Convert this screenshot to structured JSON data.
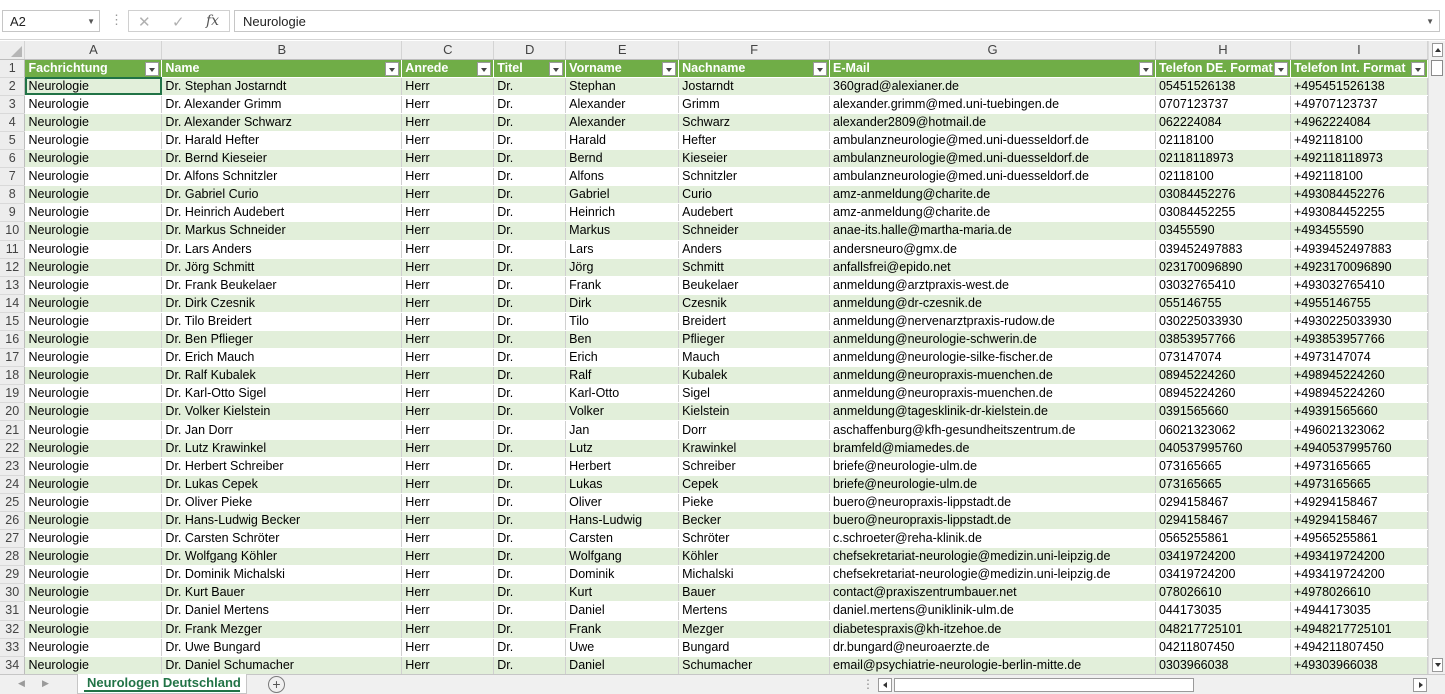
{
  "formula_bar": {
    "name_box": "A2",
    "formula_content": "Neurologie"
  },
  "columns": [
    "A",
    "B",
    "C",
    "D",
    "E",
    "F",
    "G",
    "H",
    "I"
  ],
  "table_headers": [
    "Fachrichtung",
    "Name",
    "Anrede",
    "Titel",
    "Vorname",
    "Nachname",
    "E-Mail",
    "Telefon DE. Format",
    "Telefon Int. Format"
  ],
  "rows": [
    [
      "Neurologie",
      "Dr. Stephan Jostarndt",
      "Herr",
      "Dr.",
      "Stephan",
      "Jostarndt",
      "360grad@alexianer.de",
      "05451526138",
      "+495451526138"
    ],
    [
      "Neurologie",
      "Dr. Alexander Grimm",
      "Herr",
      "Dr.",
      "Alexander",
      "Grimm",
      "alexander.grimm@med.uni-tuebingen.de",
      "0707123737",
      "+49707123737"
    ],
    [
      "Neurologie",
      "Dr. Alexander Schwarz",
      "Herr",
      "Dr.",
      "Alexander",
      "Schwarz",
      "alexander2809@hotmail.de",
      "062224084",
      "+4962224084"
    ],
    [
      "Neurologie",
      "Dr. Harald Hefter",
      "Herr",
      "Dr.",
      "Harald",
      "Hefter",
      "ambulanzneurologie@med.uni-duesseldorf.de",
      "02118100",
      "+492118100"
    ],
    [
      "Neurologie",
      "Dr. Bernd Kieseier",
      "Herr",
      "Dr.",
      "Bernd",
      "Kieseier",
      "ambulanzneurologie@med.uni-duesseldorf.de",
      "02118118973",
      "+492118118973"
    ],
    [
      "Neurologie",
      "Dr. Alfons Schnitzler",
      "Herr",
      "Dr.",
      "Alfons",
      "Schnitzler",
      "ambulanzneurologie@med.uni-duesseldorf.de",
      "02118100",
      "+492118100"
    ],
    [
      "Neurologie",
      "Dr. Gabriel Curio",
      "Herr",
      "Dr.",
      "Gabriel",
      "Curio",
      "amz-anmeldung@charite.de",
      "03084452276",
      "+493084452276"
    ],
    [
      "Neurologie",
      "Dr. Heinrich Audebert",
      "Herr",
      "Dr.",
      "Heinrich",
      "Audebert",
      "amz-anmeldung@charite.de",
      "03084452255",
      "+493084452255"
    ],
    [
      "Neurologie",
      "Dr. Markus Schneider",
      "Herr",
      "Dr.",
      "Markus",
      "Schneider",
      "anae-its.halle@martha-maria.de",
      "03455590",
      "+493455590"
    ],
    [
      "Neurologie",
      "Dr. Lars Anders",
      "Herr",
      "Dr.",
      "Lars",
      "Anders",
      "andersneuro@gmx.de",
      "039452497883",
      "+4939452497883"
    ],
    [
      "Neurologie",
      "Dr. Jörg Schmitt",
      "Herr",
      "Dr.",
      "Jörg",
      "Schmitt",
      "anfallsfrei@epido.net",
      "023170096890",
      "+4923170096890"
    ],
    [
      "Neurologie",
      "Dr. Frank Beukelaer",
      "Herr",
      "Dr.",
      "Frank",
      "Beukelaer",
      "anmeldung@arztpraxis-west.de",
      "03032765410",
      "+493032765410"
    ],
    [
      "Neurologie",
      "Dr. Dirk Czesnik",
      "Herr",
      "Dr.",
      "Dirk",
      "Czesnik",
      "anmeldung@dr-czesnik.de",
      "055146755",
      "+4955146755"
    ],
    [
      "Neurologie",
      "Dr. Tilo Breidert",
      "Herr",
      "Dr.",
      "Tilo",
      "Breidert",
      "anmeldung@nervenarztpraxis-rudow.de",
      "030225033930",
      "+4930225033930"
    ],
    [
      "Neurologie",
      "Dr. Ben Pflieger",
      "Herr",
      "Dr.",
      "Ben",
      "Pflieger",
      "anmeldung@neurologie-schwerin.de",
      "03853957766",
      "+493853957766"
    ],
    [
      "Neurologie",
      "Dr. Erich Mauch",
      "Herr",
      "Dr.",
      "Erich",
      "Mauch",
      "anmeldung@neurologie-silke-fischer.de",
      "073147074",
      "+4973147074"
    ],
    [
      "Neurologie",
      "Dr. Ralf Kubalek",
      "Herr",
      "Dr.",
      "Ralf",
      "Kubalek",
      "anmeldung@neuropraxis-muenchen.de",
      "08945224260",
      "+498945224260"
    ],
    [
      "Neurologie",
      "Dr. Karl-Otto Sigel",
      "Herr",
      "Dr.",
      "Karl-Otto",
      "Sigel",
      "anmeldung@neuropraxis-muenchen.de",
      "08945224260",
      "+498945224260"
    ],
    [
      "Neurologie",
      "Dr. Volker Kielstein",
      "Herr",
      "Dr.",
      "Volker",
      "Kielstein",
      "anmeldung@tagesklinik-dr-kielstein.de",
      "0391565660",
      "+49391565660"
    ],
    [
      "Neurologie",
      "Dr. Jan Dorr",
      "Herr",
      "Dr.",
      "Jan",
      "Dorr",
      "aschaffenburg@kfh-gesundheitszentrum.de",
      "06021323062",
      "+496021323062"
    ],
    [
      "Neurologie",
      "Dr. Lutz Krawinkel",
      "Herr",
      "Dr.",
      "Lutz",
      "Krawinkel",
      "bramfeld@miamedes.de",
      "040537995760",
      "+4940537995760"
    ],
    [
      "Neurologie",
      "Dr. Herbert Schreiber",
      "Herr",
      "Dr.",
      "Herbert",
      "Schreiber",
      "briefe@neurologie-ulm.de",
      "073165665",
      "+4973165665"
    ],
    [
      "Neurologie",
      "Dr. Lukas Cepek",
      "Herr",
      "Dr.",
      "Lukas",
      "Cepek",
      "briefe@neurologie-ulm.de",
      "073165665",
      "+4973165665"
    ],
    [
      "Neurologie",
      "Dr. Oliver Pieke",
      "Herr",
      "Dr.",
      "Oliver",
      "Pieke",
      "buero@neuropraxis-lippstadt.de",
      "0294158467",
      "+49294158467"
    ],
    [
      "Neurologie",
      "Dr. Hans-Ludwig Becker",
      "Herr",
      "Dr.",
      "Hans-Ludwig",
      "Becker",
      "buero@neuropraxis-lippstadt.de",
      "0294158467",
      "+49294158467"
    ],
    [
      "Neurologie",
      "Dr. Carsten Schröter",
      "Herr",
      "Dr.",
      "Carsten",
      "Schröter",
      "c.schroeter@reha-klinik.de",
      "0565255861",
      "+49565255861"
    ],
    [
      "Neurologie",
      "Dr. Wolfgang Köhler",
      "Herr",
      "Dr.",
      "Wolfgang",
      "Köhler",
      "chefsekretariat-neurologie@medizin.uni-leipzig.de",
      "03419724200",
      "+493419724200"
    ],
    [
      "Neurologie",
      "Dr. Dominik Michalski",
      "Herr",
      "Dr.",
      "Dominik",
      "Michalski",
      "chefsekretariat-neurologie@medizin.uni-leipzig.de",
      "03419724200",
      "+493419724200"
    ],
    [
      "Neurologie",
      "Dr. Kurt Bauer",
      "Herr",
      "Dr.",
      "Kurt",
      "Bauer",
      "contact@praxiszentrumbauer.net",
      "078026610",
      "+4978026610"
    ],
    [
      "Neurologie",
      "Dr. Daniel Mertens",
      "Herr",
      "Dr.",
      "Daniel",
      "Mertens",
      "daniel.mertens@uniklinik-ulm.de",
      "044173035",
      "+4944173035"
    ],
    [
      "Neurologie",
      "Dr. Frank Mezger",
      "Herr",
      "Dr.",
      "Frank",
      "Mezger",
      "diabetespraxis@kh-itzehoe.de",
      "048217725101",
      "+4948217725101"
    ],
    [
      "Neurologie",
      "Dr. Uwe Bungard",
      "Herr",
      "Dr.",
      "Uwe",
      "Bungard",
      "dr.bungard@neuroaerzte.de",
      "04211807450",
      "+494211807450"
    ],
    [
      "Neurologie",
      "Dr. Daniel Schumacher",
      "Herr",
      "Dr.",
      "Daniel",
      "Schumacher",
      "email@psychiatrie-neurologie-berlin-mitte.de",
      "0303966038",
      "+49303966038"
    ]
  ],
  "sheet_tabs": [
    "Neurologen Deutschland"
  ],
  "colors": {
    "header_green": "#70ad47",
    "band_green": "#e2efda",
    "excel_accent": "#217346"
  },
  "icons": {
    "cancel": "close-icon",
    "enter": "check-icon",
    "function": "fx-icon",
    "add_sheet": "plus-icon"
  }
}
